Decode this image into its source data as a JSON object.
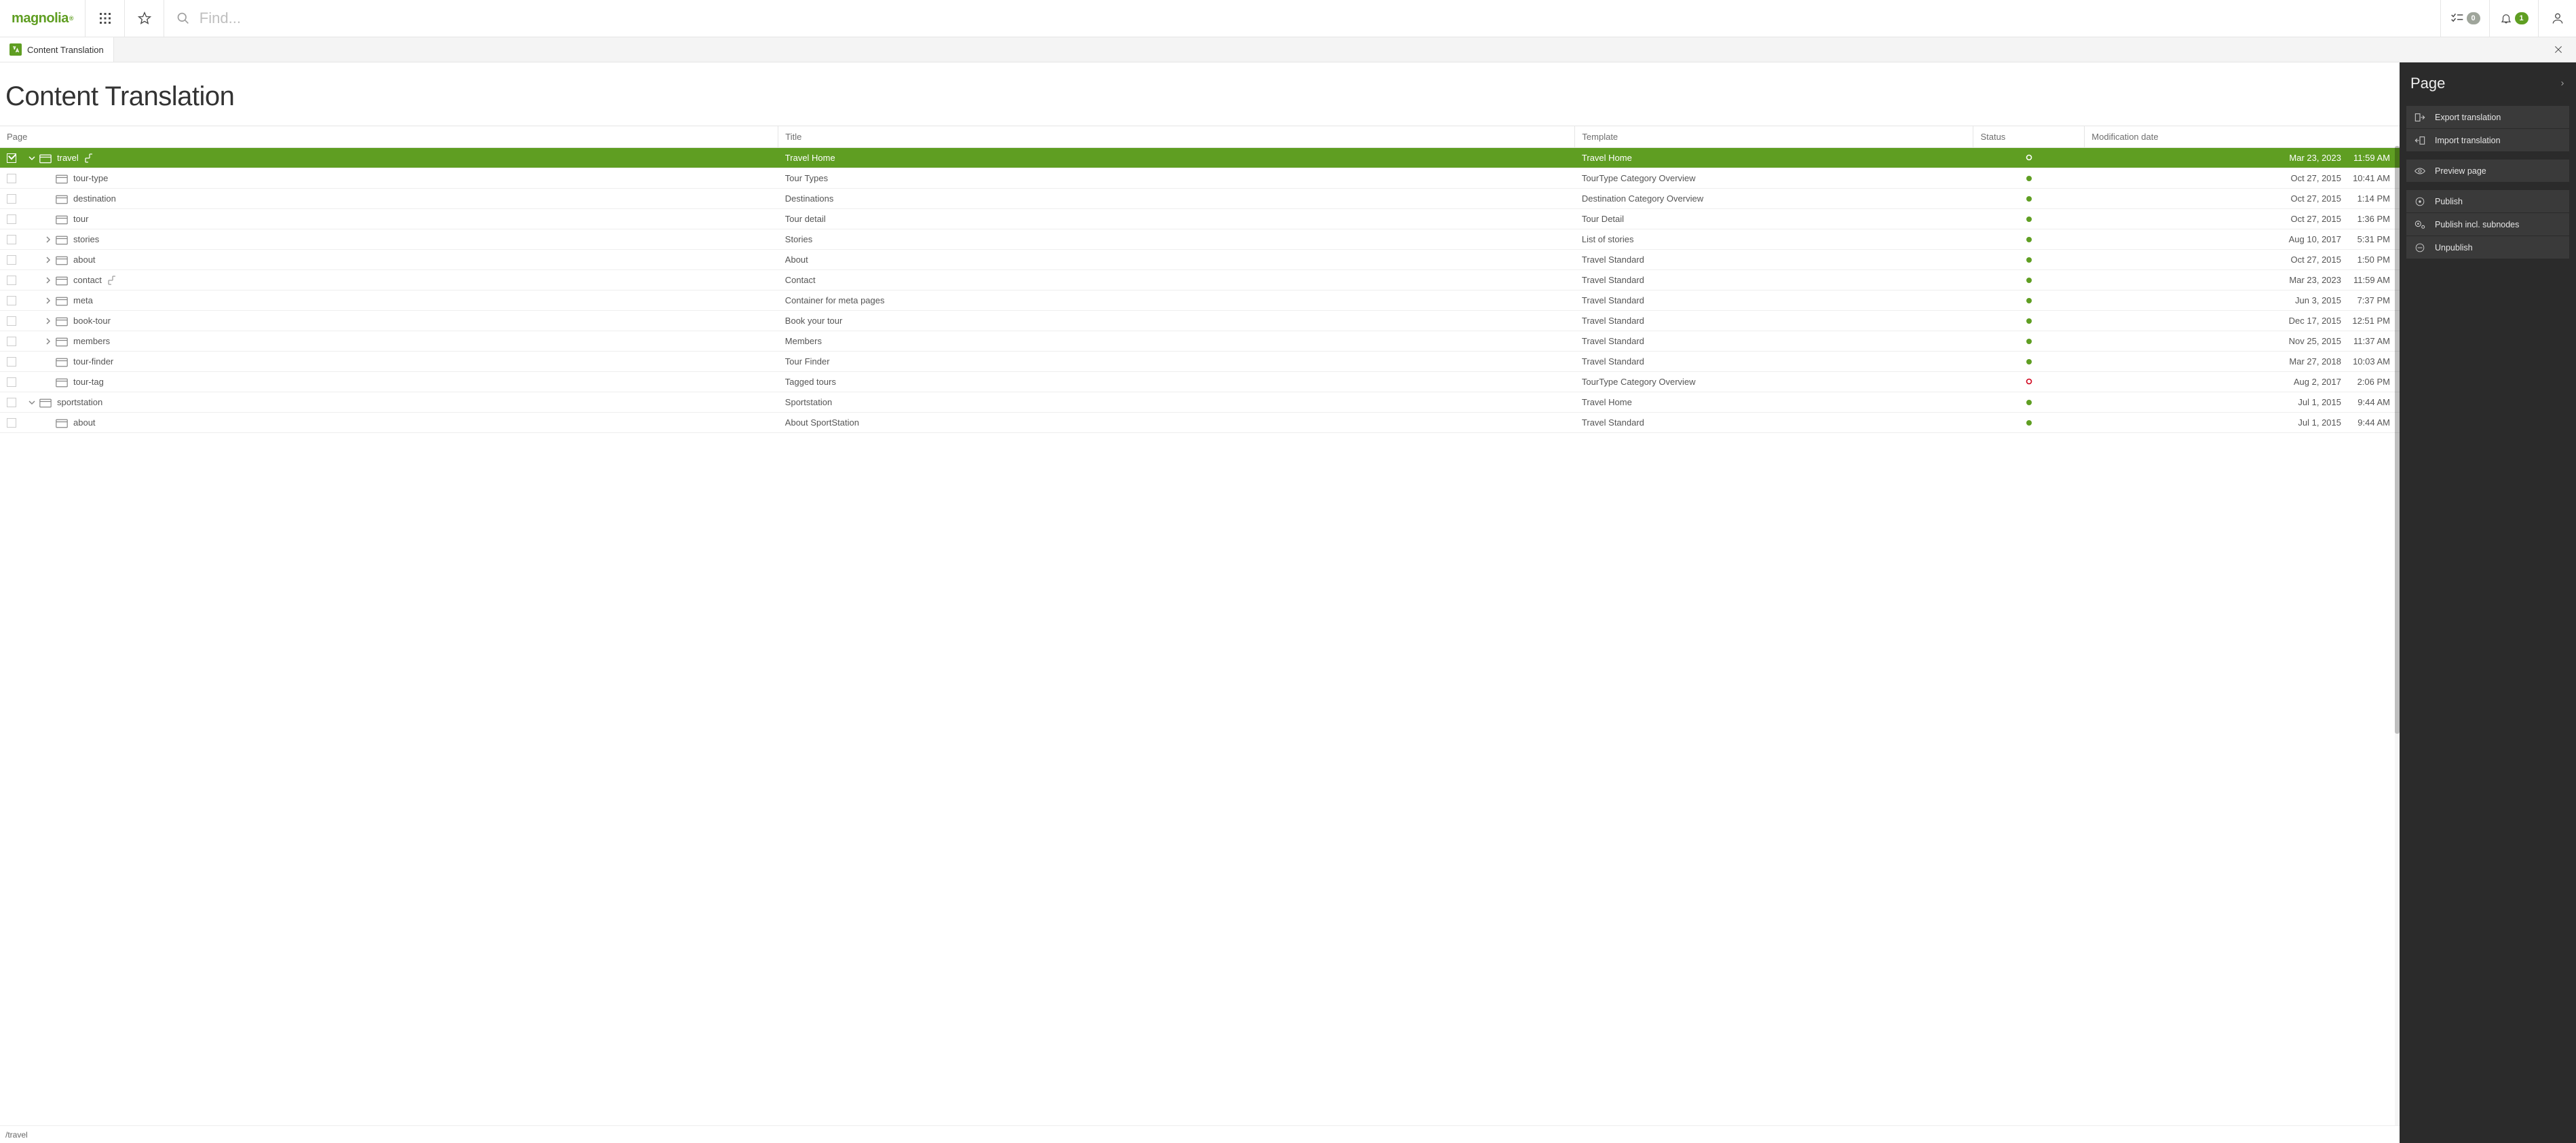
{
  "header": {
    "logo_text": "magnolia",
    "search_placeholder": "Find...",
    "tasks_badge": "0",
    "notifications_badge": "1"
  },
  "tab": {
    "label": "Content Translation"
  },
  "page_title": "Content Translation",
  "columns": {
    "page": "Page",
    "title": "Title",
    "template": "Template",
    "status": "Status",
    "date": "Modification date"
  },
  "rows": [
    {
      "depth": 0,
      "expand": "open",
      "name": "travel",
      "inh": true,
      "title": "Travel Home",
      "template": "Travel Home",
      "status": "ring",
      "date": "Mar 23, 2023",
      "time": "11:59 AM",
      "selected": true
    },
    {
      "depth": 1,
      "expand": "none",
      "name": "tour-type",
      "inh": false,
      "title": "Tour Types",
      "template": "TourType Category Overview",
      "status": "green",
      "date": "Oct 27, 2015",
      "time": "10:41 AM"
    },
    {
      "depth": 1,
      "expand": "none",
      "name": "destination",
      "inh": false,
      "title": "Destinations",
      "template": "Destination Category Overview",
      "status": "green",
      "date": "Oct 27, 2015",
      "time": "1:14 PM"
    },
    {
      "depth": 1,
      "expand": "none",
      "name": "tour",
      "inh": false,
      "title": "Tour detail",
      "template": "Tour Detail",
      "status": "green",
      "date": "Oct 27, 2015",
      "time": "1:36 PM"
    },
    {
      "depth": 1,
      "expand": "closed",
      "name": "stories",
      "inh": false,
      "title": "Stories",
      "template": "List of stories",
      "status": "green",
      "date": "Aug 10, 2017",
      "time": "5:31 PM"
    },
    {
      "depth": 1,
      "expand": "closed",
      "name": "about",
      "inh": false,
      "title": "About",
      "template": "Travel Standard",
      "status": "green",
      "date": "Oct 27, 2015",
      "time": "1:50 PM"
    },
    {
      "depth": 1,
      "expand": "closed",
      "name": "contact",
      "inh": true,
      "title": "Contact",
      "template": "Travel Standard",
      "status": "green",
      "date": "Mar 23, 2023",
      "time": "11:59 AM"
    },
    {
      "depth": 1,
      "expand": "closed",
      "name": "meta",
      "inh": false,
      "title": "Container for meta pages",
      "template": "Travel Standard",
      "status": "green",
      "date": "Jun 3, 2015",
      "time": "7:37 PM"
    },
    {
      "depth": 1,
      "expand": "closed",
      "name": "book-tour",
      "inh": false,
      "title": "Book your tour",
      "template": "Travel Standard",
      "status": "green",
      "date": "Dec 17, 2015",
      "time": "12:51 PM"
    },
    {
      "depth": 1,
      "expand": "closed",
      "name": "members",
      "inh": false,
      "title": "Members",
      "template": "Travel Standard",
      "status": "green",
      "date": "Nov 25, 2015",
      "time": "11:37 AM"
    },
    {
      "depth": 1,
      "expand": "none",
      "name": "tour-finder",
      "inh": false,
      "title": "Tour Finder",
      "template": "Travel Standard",
      "status": "green",
      "date": "Mar 27, 2018",
      "time": "10:03 AM"
    },
    {
      "depth": 1,
      "expand": "none",
      "name": "tour-tag",
      "inh": false,
      "title": "Tagged tours",
      "template": "TourType Category Overview",
      "status": "ringred",
      "date": "Aug 2, 2017",
      "time": "2:06 PM"
    },
    {
      "depth": 0,
      "expand": "open",
      "name": "sportstation",
      "inh": false,
      "title": "Sportstation",
      "template": "Travel Home",
      "status": "green",
      "date": "Jul 1, 2015",
      "time": "9:44 AM"
    },
    {
      "depth": 1,
      "expand": "none",
      "name": "about",
      "inh": false,
      "title": "About SportStation",
      "template": "Travel Standard",
      "status": "green",
      "date": "Jul 1, 2015",
      "time": "9:44 AM"
    }
  ],
  "status_path": "/travel",
  "actions_panel": {
    "title": "Page",
    "groups": [
      [
        {
          "icon": "export",
          "label": "Export translation"
        },
        {
          "icon": "import",
          "label": "Import translation"
        }
      ],
      [
        {
          "icon": "preview",
          "label": "Preview page"
        }
      ],
      [
        {
          "icon": "publish",
          "label": "Publish"
        },
        {
          "icon": "publish-incl",
          "label": "Publish incl. subnodes"
        },
        {
          "icon": "unpublish",
          "label": "Unpublish"
        }
      ]
    ]
  }
}
